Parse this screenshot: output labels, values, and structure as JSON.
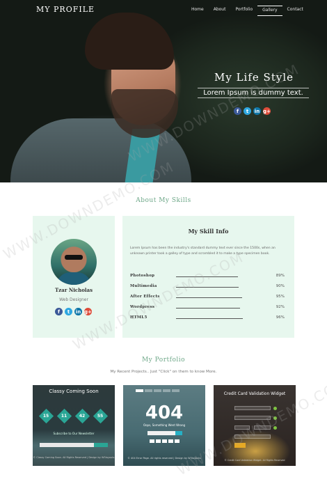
{
  "brand": "MY PROFILE",
  "nav": [
    "Home",
    "About",
    "Portfolio",
    "Gallery",
    "Contact"
  ],
  "hero": {
    "title": "My Life Style",
    "subtitle": "Lorem Ipsum is dummy text."
  },
  "social_icons": [
    "facebook-icon",
    "twitter-icon",
    "linkedin-icon",
    "google-plus-icon"
  ],
  "about": {
    "title": "About My Skills",
    "profile": {
      "name": "Tzar Nicholas",
      "role": "Web Designer"
    },
    "skills_title": "My Skill Info",
    "description": "Lorem Ipsum has been the industry's standard dummy text ever since the 1500s, when an unknown printer took a galley of type and scrambled it to make a type specimen book.",
    "skills": [
      {
        "name": "Photoshop",
        "percent": "89%",
        "level": 0.89
      },
      {
        "name": "Multimedia",
        "percent": "90%",
        "level": 0.9
      },
      {
        "name": "After Effects",
        "percent": "95%",
        "level": 0.95
      },
      {
        "name": "Wordpress",
        "percent": "92%",
        "level": 0.92
      },
      {
        "name": "HTML5",
        "percent": "96%",
        "level": 0.96
      }
    ]
  },
  "portfolio": {
    "title": "My Portfolio",
    "subtitle": "My Recent Projects.. Just \"Click\" on them to know More.",
    "items": [
      {
        "title": "Classy Coming Soon",
        "counters": [
          "15",
          "11",
          "42",
          "55"
        ],
        "subscribe": "Subscribe to Our Newsletter",
        "footer": "© Classy Coming Soon. All Rights Reserved | Design by W3layouts"
      },
      {
        "big": "404",
        "message": "Oops, Something Went Wrong",
        "footer": "© 404 Error Page. All rights reserved | Design by W3layouts"
      },
      {
        "title": "Credit Card Validation Widget",
        "footer": "© Credit Card Validation Widget. All Rights Reserved"
      }
    ]
  },
  "watermark": "WWW.DOWNDEMO.COM",
  "colors": {
    "accent": "#6fa889",
    "card_bg": "#e7f7ee",
    "teal": "#2aa595"
  }
}
